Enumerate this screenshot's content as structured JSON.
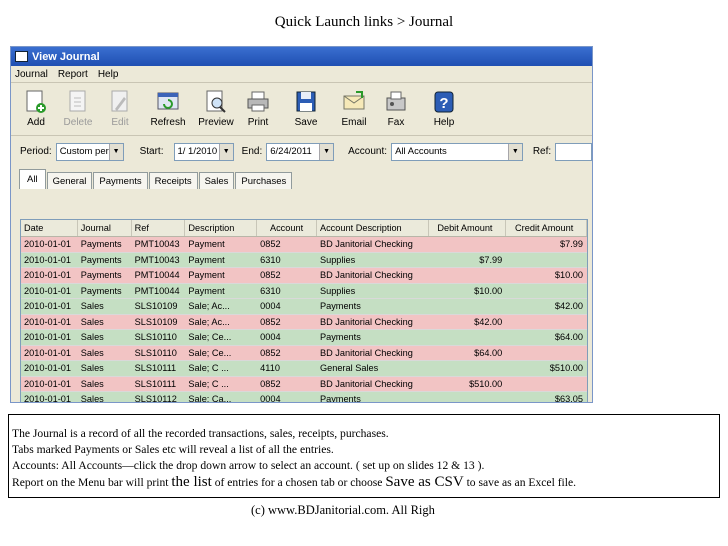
{
  "slide": {
    "title": "Quick Launch links > Journal",
    "footer": "(c) www.BDJanitorial.com.  All Righ"
  },
  "window": {
    "title": "View Journal",
    "menu": [
      "Journal",
      "Report",
      "Help"
    ]
  },
  "toolbar": [
    {
      "label": "Add",
      "icon": "add-document-icon",
      "enabled": true
    },
    {
      "label": "Delete",
      "icon": "delete-document-icon",
      "enabled": false
    },
    {
      "label": "Edit",
      "icon": "edit-document-icon",
      "enabled": false
    },
    {
      "label": "Refresh",
      "icon": "refresh-icon",
      "enabled": true
    },
    {
      "label": "Preview",
      "icon": "print-preview-icon",
      "enabled": true
    },
    {
      "label": "Print",
      "icon": "printer-icon",
      "enabled": true
    },
    {
      "label": "Save",
      "icon": "floppy-disk-icon",
      "enabled": true
    },
    {
      "label": "Email",
      "icon": "email-icon",
      "enabled": true
    },
    {
      "label": "Fax",
      "icon": "fax-icon",
      "enabled": true
    },
    {
      "label": "Help",
      "icon": "help-icon",
      "enabled": true
    }
  ],
  "filters": {
    "period_label": "Period:",
    "period_value": "Custom period",
    "start_label": "Start:",
    "start_value": "1/  1/2010",
    "end_label": "End:",
    "end_value": "6/24/2011",
    "account_label": "Account:",
    "account_value": "All Accounts",
    "ref_label": "Ref:",
    "ref_value": ""
  },
  "tabs": [
    "All",
    "General",
    "Payments",
    "Receipts",
    "Sales",
    "Purchases"
  ],
  "active_tab": "All",
  "grid": {
    "columns": [
      "Date",
      "Journal",
      "Ref",
      "Description",
      "Account",
      "Account Description",
      "Debit Amount",
      "Credit Amount"
    ],
    "rows": [
      {
        "date": "2010-01-01",
        "journal": "Payments",
        "ref": "PMT10043",
        "desc": "Payment",
        "account": "0852",
        "acct_desc": "BD Janitorial Checking",
        "debit": "",
        "credit": "$7.99",
        "color": "red"
      },
      {
        "date": "2010-01-01",
        "journal": "Payments",
        "ref": "PMT10043",
        "desc": "Payment",
        "account": "6310",
        "acct_desc": "Supplies",
        "debit": "$7.99",
        "credit": "",
        "color": "green"
      },
      {
        "date": "2010-01-01",
        "journal": "Payments",
        "ref": "PMT10044",
        "desc": "Payment",
        "account": "0852",
        "acct_desc": "BD Janitorial Checking",
        "debit": "",
        "credit": "$10.00",
        "color": "red"
      },
      {
        "date": "2010-01-01",
        "journal": "Payments",
        "ref": "PMT10044",
        "desc": "Payment",
        "account": "6310",
        "acct_desc": "Supplies",
        "debit": "$10.00",
        "credit": "",
        "color": "green"
      },
      {
        "date": "2010-01-01",
        "journal": "Sales",
        "ref": "SLS10109",
        "desc": "Sale; Ac...",
        "account": "0004",
        "acct_desc": "Payments",
        "debit": "",
        "credit": "$42.00",
        "color": "green"
      },
      {
        "date": "2010-01-01",
        "journal": "Sales",
        "ref": "SLS10109",
        "desc": "Sale; Ac...",
        "account": "0852",
        "acct_desc": "BD Janitorial Checking",
        "debit": "$42.00",
        "credit": "",
        "color": "red"
      },
      {
        "date": "2010-01-01",
        "journal": "Sales",
        "ref": "SLS10110",
        "desc": "Sale; Ce...",
        "account": "0004",
        "acct_desc": "Payments",
        "debit": "",
        "credit": "$64.00",
        "color": "green"
      },
      {
        "date": "2010-01-01",
        "journal": "Sales",
        "ref": "SLS10110",
        "desc": "Sale; Ce...",
        "account": "0852",
        "acct_desc": "BD Janitorial Checking",
        "debit": "$64.00",
        "credit": "",
        "color": "red"
      },
      {
        "date": "2010-01-01",
        "journal": "Sales",
        "ref": "SLS10111",
        "desc": "Sale; C ...",
        "account": "4110",
        "acct_desc": "General Sales",
        "debit": "",
        "credit": "$510.00",
        "color": "green"
      },
      {
        "date": "2010-01-01",
        "journal": "Sales",
        "ref": "SLS10111",
        "desc": "Sale; C ...",
        "account": "0852",
        "acct_desc": "BD Janitorial Checking",
        "debit": "$510.00",
        "credit": "",
        "color": "red"
      },
      {
        "date": "2010-01-01",
        "journal": "Sales",
        "ref": "SLS10112",
        "desc": "Sale; Ca...",
        "account": "0004",
        "acct_desc": "Payments",
        "debit": "",
        "credit": "$63.05",
        "color": "green"
      }
    ]
  },
  "caption": {
    "line1": "The Journal is a record of all the recorded transactions, sales, receipts, purchases.",
    "line2": "Tabs marked Payments or Sales etc will reveal a list of all the entries.",
    "line3": "Accounts: All Accounts—click the drop down arrow to select an account. ( set up on slides 12 & 13 ).",
    "line4_a": "Report on the Menu bar will print ",
    "line4_b": "the list",
    "line4_c": " of entries for a chosen tab or choose ",
    "line4_d": "Save as CSV",
    "line4_e": " to save as an Excel file."
  },
  "colors": {
    "debit_row": "#f2c4c4",
    "credit_row": "#c5dfc3",
    "titlebar": "#1f4fb2",
    "window_bg": "#ece9d8"
  }
}
